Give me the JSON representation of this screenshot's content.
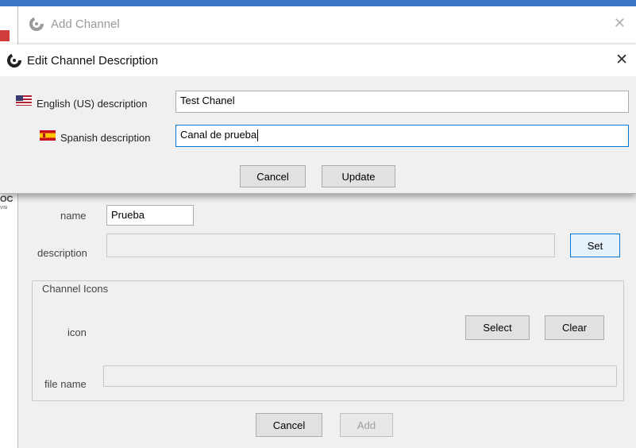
{
  "add_channel": {
    "title": "Add Channel",
    "close_glyph": "✕",
    "name_label": "name",
    "name_value": "Prueba",
    "description_label": "description",
    "description_value": "",
    "set_button": "Set",
    "icons_group_title": "Channel Icons",
    "icon_label": "icon",
    "select_button": "Select",
    "clear_button": "Clear",
    "file_name_label": "file name",
    "file_name_value": "",
    "cancel_button": "Cancel",
    "add_button": "Add"
  },
  "edit_dialog": {
    "title": "Edit Channel Description",
    "close_glyph": "✕",
    "english_label": "English (US) description",
    "english_value": "Test Chanel",
    "spanish_label": "Spanish description",
    "spanish_value": "Canal de prueba",
    "cancel_button": "Cancel",
    "update_button": "Update"
  },
  "background": {
    "left_text": "OC",
    "left_small": "VISI"
  },
  "icons": {
    "app_logo": "app-logo-icon",
    "us_flag": "us-flag-icon",
    "spain_flag": "spain-flag-icon",
    "close": "close-icon"
  }
}
